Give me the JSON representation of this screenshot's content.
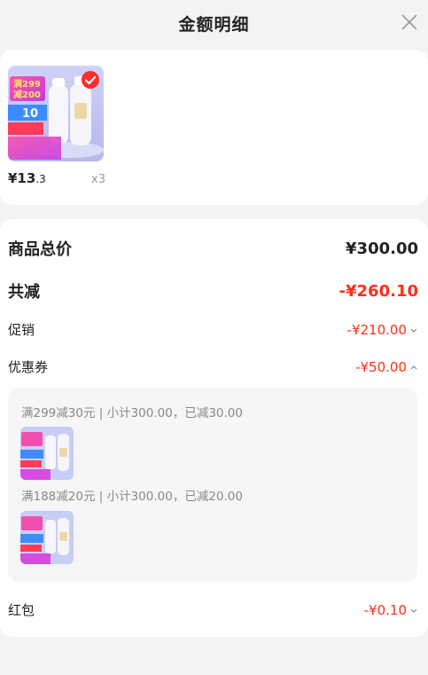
{
  "header": {
    "title": "金额明细"
  },
  "product": {
    "price_symbol": "¥13",
    "price_decimal": ".3",
    "quantity": "x3",
    "promo_text_1": "满299",
    "promo_text_2": "减200",
    "promo_coupon": "10"
  },
  "summary": {
    "total_label": "商品总价",
    "total_value": "¥300.00",
    "discount_label": "共减",
    "discount_value": "-¥260.10",
    "promo_label": "促销",
    "promo_value": "-¥210.00",
    "coupon_label": "优惠券",
    "coupon_value": "-¥50.00",
    "redpacket_label": "红包",
    "redpacket_value": "-¥0.10"
  },
  "coupons": [
    {
      "text": "满299减30元 | 小计300.00，已减30.00"
    },
    {
      "text": "满188减20元 | 小计300.00，已减20.00"
    }
  ],
  "colors": {
    "accent_red": "#ff2d1a",
    "background": "#f3f3f3"
  },
  "icons": {
    "close": "close-icon",
    "check": "check-badge-icon",
    "chevron_down": "chevron-down-icon",
    "chevron_up": "chevron-up-icon"
  }
}
